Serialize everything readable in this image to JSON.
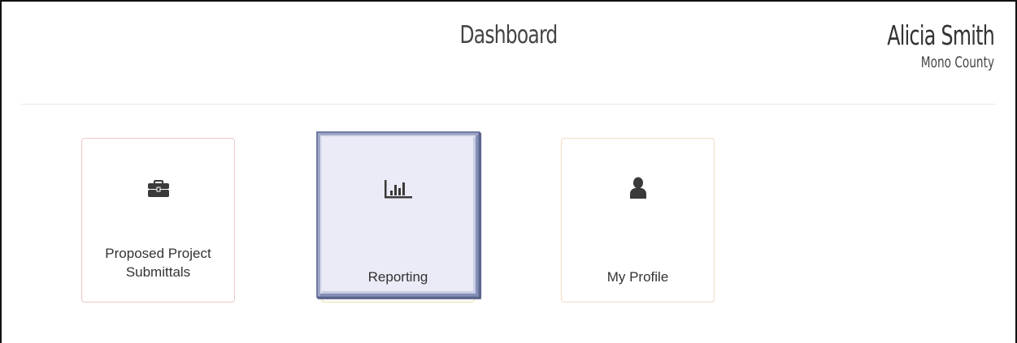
{
  "header": {
    "title": "Dashboard",
    "user_name": "Alicia Smith",
    "user_county": "Mono County"
  },
  "tiles": [
    {
      "label_line1": "Proposed Project",
      "label_line2": "Submittals",
      "icon": "briefcase-icon",
      "border_color": "#f0c8c8"
    },
    {
      "label": "Reporting",
      "icon": "bar-chart-icon",
      "highlighted": true,
      "border_color": "#e9e3a8"
    },
    {
      "label": "My Profile",
      "icon": "user-icon",
      "border_color": "#f3dcc0"
    }
  ]
}
